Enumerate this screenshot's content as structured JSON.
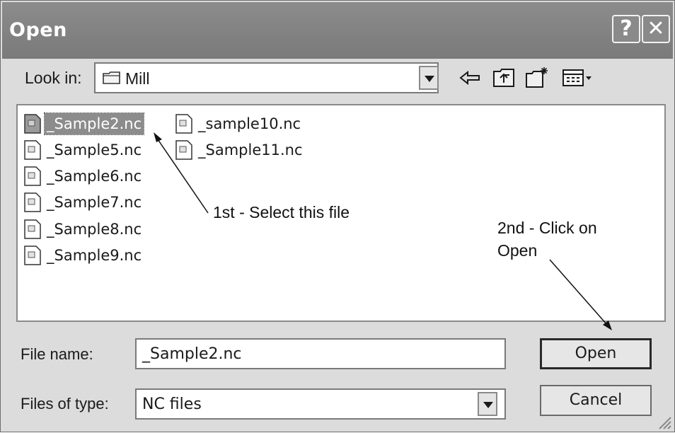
{
  "window": {
    "title": "Open",
    "help_label": "?",
    "close_label": "✕"
  },
  "lookin": {
    "label": "Look in:",
    "value": "Mill",
    "folder_icon": "folder-icon"
  },
  "toolbar": {
    "icons": [
      "back-icon",
      "up-folder-icon",
      "new-folder-icon",
      "view-menu-icon"
    ]
  },
  "files": [
    {
      "name": "_Sample2.nc",
      "selected": true
    },
    {
      "name": "_Sample5.nc",
      "selected": false
    },
    {
      "name": "_Sample6.nc",
      "selected": false
    },
    {
      "name": "_Sample7.nc",
      "selected": false
    },
    {
      "name": "_Sample8.nc",
      "selected": false
    },
    {
      "name": "_Sample9.nc",
      "selected": false
    },
    {
      "name": "_sample10.nc",
      "selected": false
    },
    {
      "name": "_Sample11.nc",
      "selected": false
    }
  ],
  "annotations": {
    "step1": "1st - Select this file",
    "step2_line1": "2nd - Click on",
    "step2_line2": "Open"
  },
  "filename": {
    "label": "File name:",
    "value": "_Sample2.nc"
  },
  "filetype": {
    "label": "Files of type:",
    "value": "NC files"
  },
  "buttons": {
    "open": "Open",
    "cancel": "Cancel"
  }
}
